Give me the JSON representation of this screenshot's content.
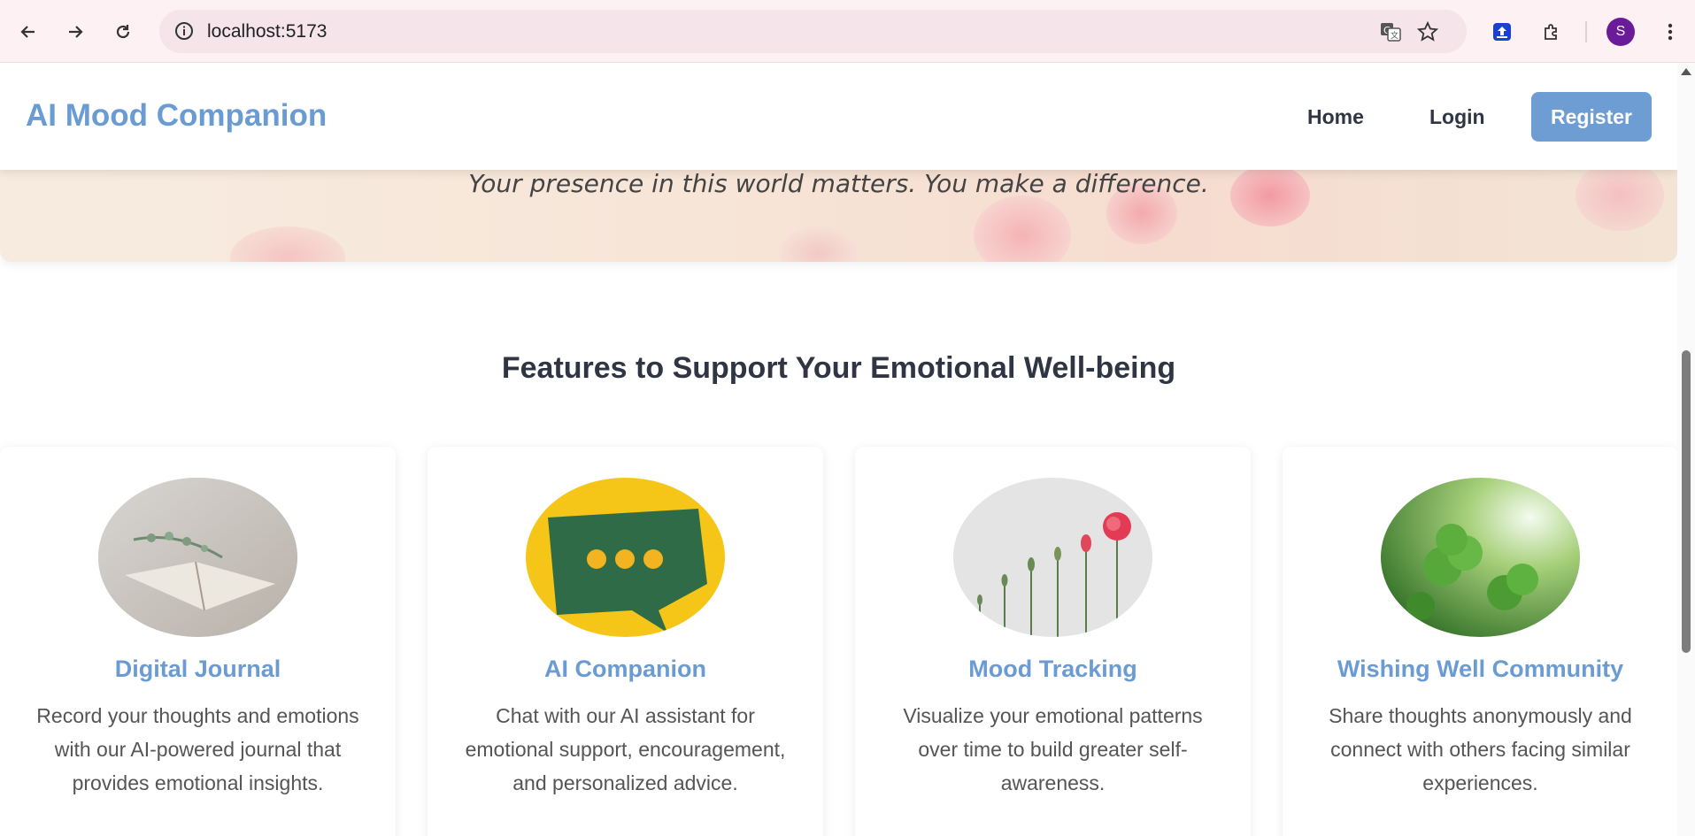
{
  "browser": {
    "url": "localhost:5173",
    "profile_initial": "S",
    "icons": [
      "back-icon",
      "forward-icon",
      "reload-icon",
      "info-icon",
      "translate-icon",
      "star-icon",
      "extension-upload-icon",
      "puzzle-icon",
      "more-icon"
    ]
  },
  "header": {
    "logo": "AI Mood Companion",
    "nav": {
      "home": "Home",
      "login": "Login",
      "register": "Register"
    },
    "accent": "#6a9bd3"
  },
  "hero": {
    "quote": "Your presence in this world matters. You make a difference."
  },
  "features": {
    "title": "Features to Support Your Emotional Well-being",
    "cards": [
      {
        "title": "Digital Journal",
        "description": "Record your thoughts and emotions with our AI-powered journal that provides emotional insights."
      },
      {
        "title": "AI Companion",
        "description": "Chat with our AI assistant for emotional support, encouragement, and personalized advice."
      },
      {
        "title": "Mood Tracking",
        "description": "Visualize your emotional patterns over time to build greater self-awareness."
      },
      {
        "title": "Wishing Well Community",
        "description": "Share thoughts anonymously and connect with others facing similar experiences."
      }
    ]
  }
}
